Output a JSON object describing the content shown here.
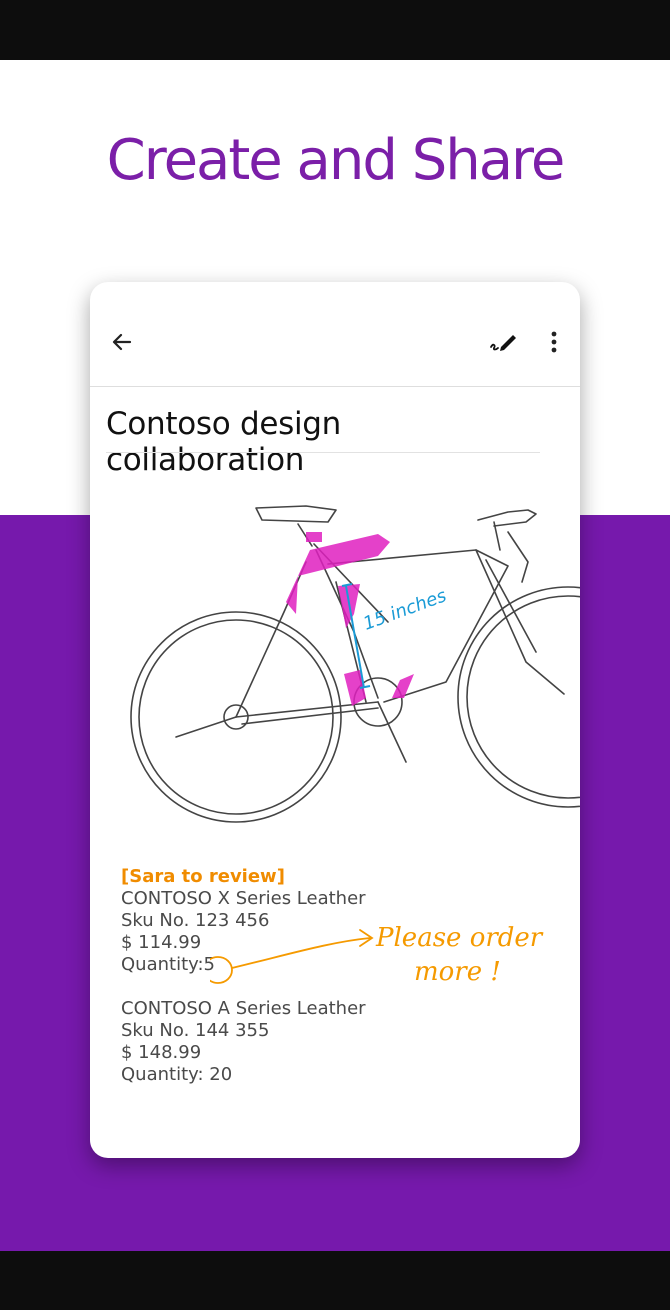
{
  "headline": "Create and Share",
  "note": {
    "title": "Contoso design collaboration",
    "sketch_annotation": "15 inches",
    "review_tag": "[Sara to review]",
    "products": [
      {
        "name": "CONTOSO X Series Leather",
        "sku": "Sku No. 123 456",
        "price": "$ 114.99",
        "quantity_label": "Quantity:",
        "quantity_value": "5"
      },
      {
        "name": "CONTOSO A Series Leather",
        "sku": "Sku No. 144 355",
        "price": "$ 148.99",
        "quantity_label": "Quantity:",
        "quantity_value": "20"
      }
    ],
    "handwritten": [
      "Please order",
      "more !"
    ]
  },
  "toolbar": {
    "icons": [
      "back-arrow-icon",
      "pen-icon",
      "more-vertical-icon"
    ]
  },
  "colors": {
    "headline": "#7b1fa8",
    "band": "#7619ac",
    "review_tag": "#f08c00",
    "highlight": "#e020c0",
    "measure": "#1a9bd6",
    "ink": "#f59a00"
  }
}
